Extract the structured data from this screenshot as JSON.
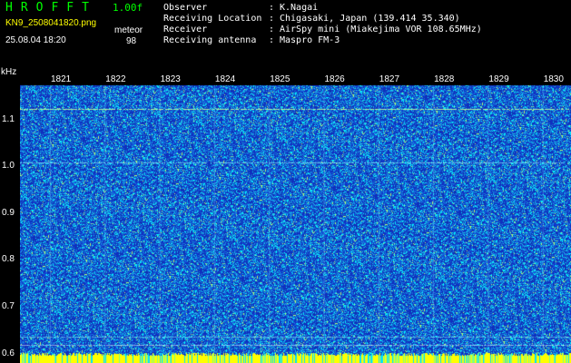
{
  "header": {
    "app_title": "HROFFT",
    "version": "1.00f",
    "filename": "KN9_2508041820.png",
    "datetime": "25.08.04 18:20",
    "meteor_label": "meteor",
    "meteor_count": "98"
  },
  "info": [
    {
      "label": "Observer",
      "value": "K.Nagai"
    },
    {
      "label": "Receiving Location",
      "value": "Chigasaki, Japan (139.414 35.340)"
    },
    {
      "label": "Receiver",
      "value": "AirSpy mini (Miakejima VOR 108.65MHz)"
    },
    {
      "label": "Receiving antenna",
      "value": "Maspro FM-3"
    }
  ],
  "axis": {
    "unit": "kHz",
    "y_labels": [
      "1.1",
      "1.0",
      "0.9",
      "0.8",
      "0.7",
      "0.6"
    ],
    "y_range": [
      0.58,
      1.2
    ],
    "x_labels": [
      "1821",
      "1822",
      "1823",
      "1824",
      "1825",
      "1826",
      "1827",
      "1828",
      "1829",
      "1830"
    ]
  },
  "colors": {
    "background": "#000000",
    "text_green": "#00ff00",
    "text_white": "#ffffff",
    "text_yellow": "#ffff00",
    "noise_base": "#1040c0",
    "noise_cyan": "#00ffff",
    "bottom_band": "#ffff00"
  }
}
